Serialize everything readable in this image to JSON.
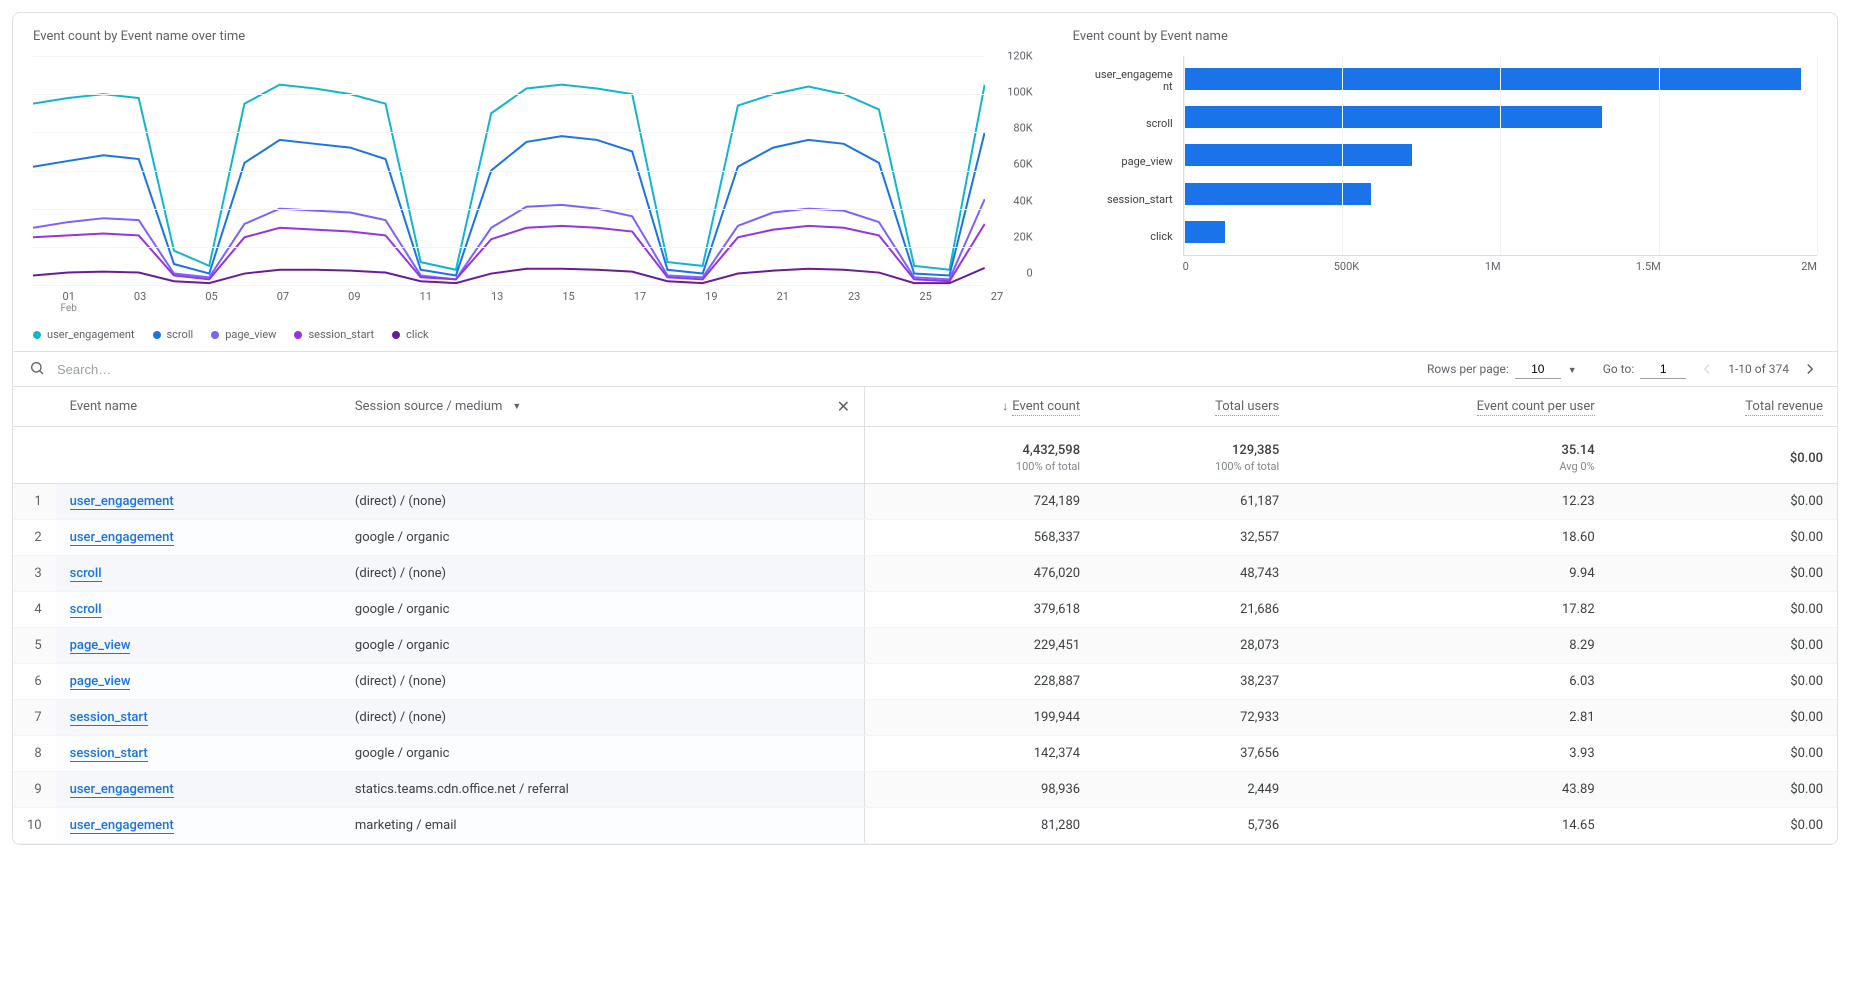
{
  "charts": {
    "line_title": "Event count by Event name over time",
    "bar_title": "Event count by Event name"
  },
  "legend": {
    "items": [
      {
        "label": "user_engagement",
        "color": "#12b5cb"
      },
      {
        "label": "scroll",
        "color": "#1a73e8"
      },
      {
        "label": "page_view",
        "color": "#7b61ff"
      },
      {
        "label": "session_start",
        "color": "#9334e6"
      },
      {
        "label": "click",
        "color": "#6a1b9a"
      }
    ]
  },
  "chart_data": [
    {
      "type": "line",
      "title": "Event count by Event name over time",
      "xlabel": "",
      "ylabel": "",
      "ylim": [
        0,
        120000
      ],
      "yticks": [
        "120K",
        "100K",
        "80K",
        "60K",
        "40K",
        "20K",
        "0"
      ],
      "x_month": "Feb",
      "x": [
        "01",
        "03",
        "05",
        "07",
        "09",
        "11",
        "13",
        "15",
        "17",
        "19",
        "21",
        "23",
        "25",
        "27"
      ],
      "series": [
        {
          "name": "user_engagement",
          "color": "#12b5cb",
          "values": [
            95000,
            98000,
            100000,
            98000,
            18000,
            10000,
            95000,
            105000,
            103000,
            100000,
            95000,
            12000,
            8000,
            90000,
            103000,
            105000,
            103000,
            100000,
            12000,
            10000,
            94000,
            100000,
            104000,
            100000,
            92000,
            10000,
            8000,
            105000
          ]
        },
        {
          "name": "scroll",
          "color": "#1a73e8",
          "values": [
            62000,
            65000,
            68000,
            66000,
            11000,
            6000,
            64000,
            76000,
            74000,
            72000,
            66000,
            8000,
            5000,
            60000,
            75000,
            78000,
            76000,
            70000,
            8000,
            6000,
            62000,
            72000,
            76000,
            74000,
            64000,
            6000,
            5000,
            80000
          ]
        },
        {
          "name": "page_view",
          "color": "#7b61ff",
          "values": [
            30000,
            33000,
            35000,
            34000,
            6000,
            4000,
            32000,
            40000,
            39000,
            38000,
            34000,
            5000,
            3000,
            30000,
            41000,
            42000,
            40000,
            36000,
            5000,
            4000,
            31000,
            38000,
            40000,
            39000,
            33000,
            4000,
            3000,
            45000
          ]
        },
        {
          "name": "session_start",
          "color": "#9334e6",
          "values": [
            25000,
            26000,
            27000,
            26000,
            5000,
            3000,
            25000,
            30000,
            29000,
            28000,
            26000,
            4000,
            3000,
            24000,
            30000,
            31000,
            30000,
            28000,
            4000,
            3000,
            25000,
            29000,
            31000,
            30000,
            26000,
            3000,
            2000,
            32000
          ]
        },
        {
          "name": "click",
          "color": "#6a1b9a",
          "values": [
            5000,
            6500,
            7000,
            6500,
            2000,
            1000,
            6000,
            8000,
            8000,
            7500,
            6500,
            2000,
            1000,
            6000,
            8500,
            8500,
            8000,
            7000,
            2000,
            1000,
            6000,
            7500,
            8500,
            8000,
            6500,
            1000,
            1000,
            9000
          ]
        }
      ]
    },
    {
      "type": "bar",
      "orientation": "horizontal",
      "title": "Event count by Event name",
      "xlabel": "",
      "ylabel": "",
      "xlim": [
        0,
        2000000
      ],
      "xticks": [
        "0",
        "500K",
        "1M",
        "1.5M",
        "2M"
      ],
      "categories": [
        "user_engagement",
        "scroll",
        "page_view",
        "session_start",
        "click"
      ],
      "values": [
        1950000,
        1320000,
        720000,
        590000,
        130000
      ],
      "bar_category_labels": {
        "0": "user_engageme\nnt",
        "1": "scroll",
        "2": "page_view",
        "3": "session_start",
        "4": "click"
      }
    }
  ],
  "toolbar": {
    "search_placeholder": "Search…",
    "rows_per_page_label": "Rows per page:",
    "rows_per_page_value": "10",
    "goto_label": "Go to:",
    "goto_value": "1",
    "range_label": "1-10 of 374"
  },
  "table": {
    "headers": {
      "event_name": "Event name",
      "source_medium": "Session source / medium",
      "event_count": "Event count",
      "total_users": "Total users",
      "event_count_per_user": "Event count per user",
      "total_revenue": "Total revenue"
    },
    "summary": {
      "event_count": "4,432,598",
      "event_count_sub": "100% of total",
      "total_users": "129,385",
      "total_users_sub": "100% of total",
      "per_user": "35.14",
      "per_user_sub": "Avg 0%",
      "revenue": "$0.00"
    },
    "rows": [
      {
        "idx": "1",
        "event": "user_engagement",
        "source": "(direct) / (none)",
        "count": "724,189",
        "users": "61,187",
        "per": "12.23",
        "rev": "$0.00"
      },
      {
        "idx": "2",
        "event": "user_engagement",
        "source": "google / organic",
        "count": "568,337",
        "users": "32,557",
        "per": "18.60",
        "rev": "$0.00"
      },
      {
        "idx": "3",
        "event": "scroll",
        "source": "(direct) / (none)",
        "count": "476,020",
        "users": "48,743",
        "per": "9.94",
        "rev": "$0.00"
      },
      {
        "idx": "4",
        "event": "scroll",
        "source": "google / organic",
        "count": "379,618",
        "users": "21,686",
        "per": "17.82",
        "rev": "$0.00"
      },
      {
        "idx": "5",
        "event": "page_view",
        "source": "google / organic",
        "count": "229,451",
        "users": "28,073",
        "per": "8.29",
        "rev": "$0.00"
      },
      {
        "idx": "6",
        "event": "page_view",
        "source": "(direct) / (none)",
        "count": "228,887",
        "users": "38,237",
        "per": "6.03",
        "rev": "$0.00"
      },
      {
        "idx": "7",
        "event": "session_start",
        "source": "(direct) / (none)",
        "count": "199,944",
        "users": "72,933",
        "per": "2.81",
        "rev": "$0.00"
      },
      {
        "idx": "8",
        "event": "session_start",
        "source": "google / organic",
        "count": "142,374",
        "users": "37,656",
        "per": "3.93",
        "rev": "$0.00"
      },
      {
        "idx": "9",
        "event": "user_engagement",
        "source": "statics.teams.cdn.office.net / referral",
        "count": "98,936",
        "users": "2,449",
        "per": "43.89",
        "rev": "$0.00"
      },
      {
        "idx": "10",
        "event": "user_engagement",
        "source": "marketing / email",
        "count": "81,280",
        "users": "5,736",
        "per": "14.65",
        "rev": "$0.00"
      }
    ]
  }
}
